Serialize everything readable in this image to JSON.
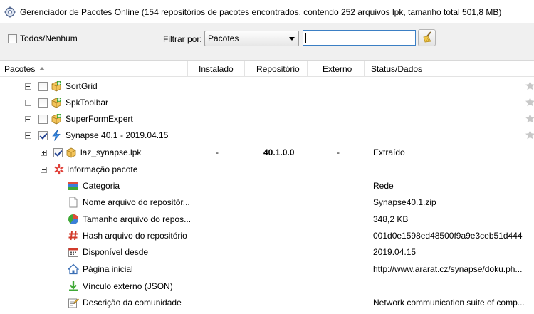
{
  "window": {
    "title": "Gerenciador de Pacotes Online (154 repositórios de pacotes encontrados, contendo 252 arquivos lpk, tamanho total 501,8 MB)"
  },
  "toolbar": {
    "all_none_label": "Todos/Nenhum",
    "filter_label": "Filtrar por:",
    "filter_value": "Pacotes",
    "search_value": ""
  },
  "columns": {
    "packages": "Pacotes",
    "installed": "Instalado",
    "repository": "Repositório",
    "external": "Externo",
    "status": "Status/Dados"
  },
  "packages": [
    {
      "name": "SortGrid",
      "checked": false
    },
    {
      "name": "SpkToolbar",
      "checked": false
    },
    {
      "name": "SuperFormExpert",
      "checked": false
    }
  ],
  "expanded_package": {
    "name": "Synapse 40.1",
    "date": "- 2019.04.15",
    "checked": true,
    "lpk": {
      "name": "laz_synapse.lpk",
      "installed": "-",
      "repository": "40.1.0.0",
      "external": "-",
      "status": "Extraído"
    },
    "info_label": "Informação pacote",
    "details": [
      {
        "label": "Categoria",
        "value": "Rede",
        "icon": "category-icon"
      },
      {
        "label": "Nome arquivo do repositór...",
        "value": "Synapse40.1.zip",
        "icon": "file-icon"
      },
      {
        "label": "Tamanho arquivo do repos...",
        "value": "348,2 KB",
        "icon": "size-icon"
      },
      {
        "label": "Hash arquivo do repositório",
        "value": "001d0e1598ed48500f9a9e3ceb51d444",
        "icon": "hash-icon"
      },
      {
        "label": "Disponível desde",
        "value": "2019.04.15",
        "icon": "calendar-icon"
      },
      {
        "label": "Página inicial",
        "value": "http://www.ararat.cz/synapse/doku.ph...",
        "icon": "home-icon"
      },
      {
        "label": "Vínculo externo (JSON)",
        "value": "",
        "icon": "download-icon"
      },
      {
        "label": "Descrição da comunidade",
        "value": "Network communication suite of comp...",
        "icon": "note-icon"
      }
    ]
  }
}
